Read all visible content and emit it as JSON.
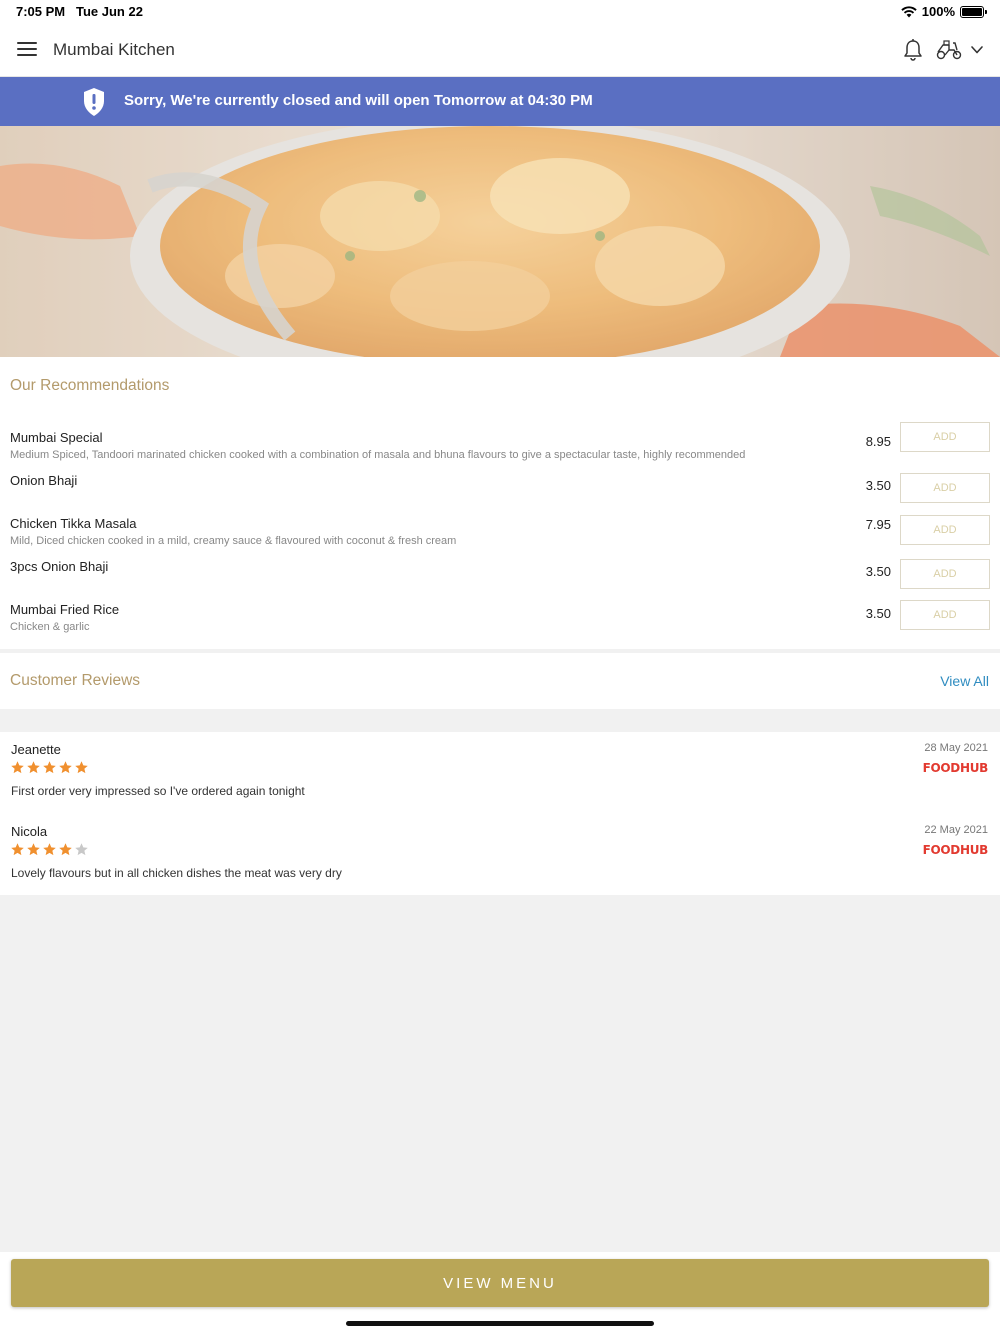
{
  "status_bar": {
    "time": "7:05 PM",
    "date": "Tue Jun 22",
    "battery": "100%"
  },
  "header": {
    "title": "Mumbai Kitchen",
    "icons": [
      "menu-icon",
      "bell-icon",
      "delivery-scooter-icon",
      "chevron-down-icon"
    ]
  },
  "banner": {
    "icon": "shield-alert-icon",
    "message": "Sorry, We're currently closed and will open Tomorrow at 04:30 PM",
    "color": "#5a6fc2"
  },
  "recommendations": {
    "title": "Our Recommendations",
    "items": [
      {
        "name": "Mumbai Special",
        "description": "Medium Spiced, Tandoori marinated chicken cooked with a combination of masala and bhuna flavours to give a spectacular taste, highly recommended",
        "price": "8.95",
        "button": "ADD"
      },
      {
        "name": "Onion Bhaji",
        "description": "",
        "price": "3.50",
        "button": "ADD"
      },
      {
        "name": "Chicken Tikka Masala",
        "description": "Mild, Diced chicken cooked in a mild, creamy sauce & flavoured with coconut & fresh cream",
        "price": "7.95",
        "button": "ADD"
      },
      {
        "name": "3pcs Onion Bhaji",
        "description": "",
        "price": "3.50",
        "button": "ADD"
      },
      {
        "name": "Mumbai Fried Rice",
        "description": "Chicken & garlic",
        "price": "3.50",
        "button": "ADD"
      }
    ]
  },
  "reviews": {
    "title": "Customer Reviews",
    "view_all": "View All",
    "items": [
      {
        "name": "Jeanette",
        "date": "28 May 2021",
        "rating": 5,
        "max_rating": 5,
        "source": "FOODHUB",
        "text": "First order very impressed so I've ordered again tonight"
      },
      {
        "name": "Nicola",
        "date": "22 May 2021",
        "rating": 4,
        "max_rating": 5,
        "source": "FOODHUB",
        "text": "Lovely flavours but in all chicken dishes the meat was very dry"
      }
    ]
  },
  "footer": {
    "view_menu": "VIEW MENU",
    "accent_color": "#b9a657"
  }
}
